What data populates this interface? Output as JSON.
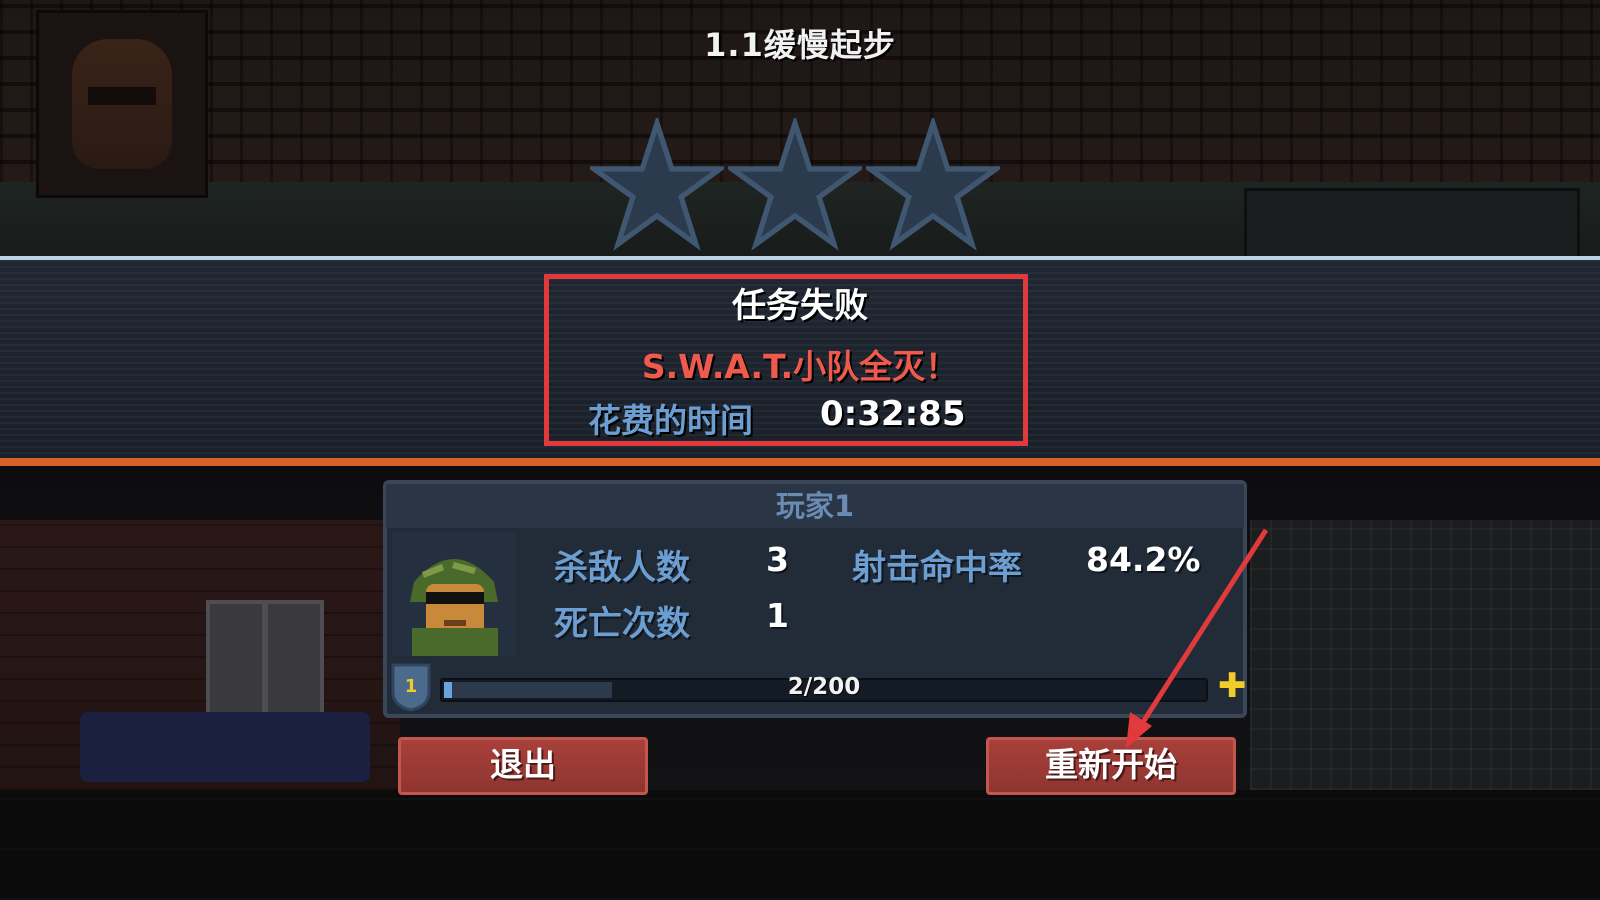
{
  "level": {
    "title": "1.1缓慢起步"
  },
  "stars": {
    "earned": 0,
    "total": 3,
    "empty_color": "#2b3a4c",
    "outline_color": "#3f5770"
  },
  "result": {
    "status": "任务失败",
    "reason": "S.W.A.T.小队全灭！",
    "time_label": "花费的时间",
    "time_value": "0:32:85"
  },
  "player": {
    "name": "玩家1",
    "stats": {
      "kills_label": "杀敌人数",
      "kills_value": "3",
      "accuracy_label": "射击命中率",
      "accuracy_value": "84.2%",
      "deaths_label": "死亡次数",
      "deaths_value": "1"
    },
    "level": "1",
    "xp_text": "2/200",
    "xp_fraction": 0.01
  },
  "buttons": {
    "exit": "退出",
    "restart": "重新开始"
  },
  "colors": {
    "accent_red": "#e23a3c",
    "fail_text": "#ef5a4d",
    "label_blue": "#6c9ed2",
    "button": "#a03c37",
    "band_line_orange": "#d4622a"
  },
  "icons": [
    "player-portrait-icon",
    "star-icon",
    "level-shield-icon",
    "plus-icon",
    "soldier-avatar-icon",
    "annotation-arrow"
  ]
}
